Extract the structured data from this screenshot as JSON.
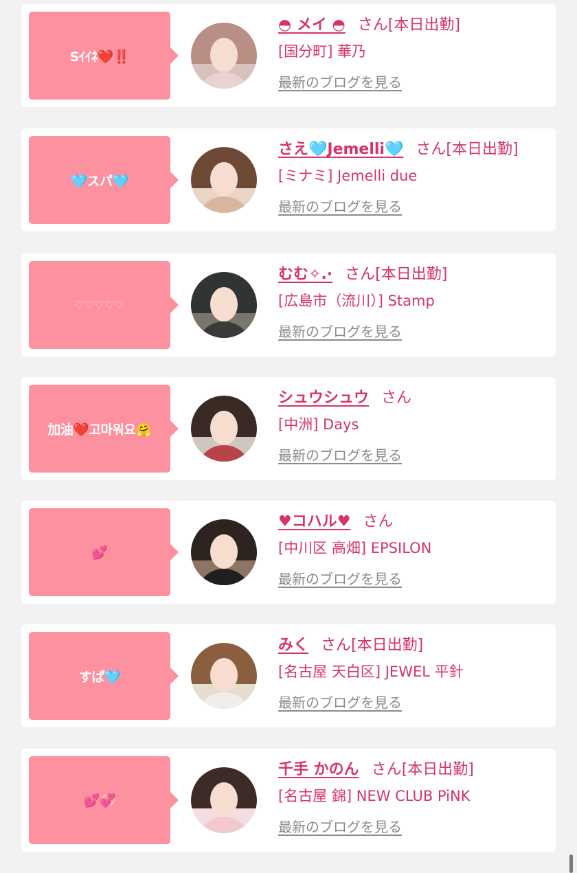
{
  "cards": [
    {
      "comment": "Sｲｲﾈ❤️‼️",
      "name": "◓ メイ ◓",
      "san": "さん",
      "status": "[本日出勤]",
      "store": "[国分町] 華乃",
      "blog_link": "最新のブログを見る",
      "avatar": {
        "hair": "#b98e84",
        "body": "#e8d3cf",
        "bg": "#d9c2bd"
      }
    },
    {
      "comment": "🩵スパ🩵",
      "name": "さえ🩵Jemelli🩵",
      "san": "さん",
      "status": "[本日出勤]",
      "store": "[ミナミ] Jemelli due",
      "blog_link": "最新のブログを見る",
      "avatar": {
        "hair": "#6e4a36",
        "body": "#d9b6a0",
        "bg": "#e9d5c8"
      }
    },
    {
      "comment": "♡♡♡♡♡",
      "name": "むむ✧.·",
      "san": "さん",
      "status": "[本日出勤]",
      "store": "[広島市（流川）] Stamp",
      "blog_link": "最新のブログを見る",
      "avatar": {
        "hair": "#2f3535",
        "body": "#3a3a3a",
        "bg": "#7a766d"
      }
    },
    {
      "comment": "加油❤️고마워요🤗",
      "name": "シュウシュウ",
      "san": "さん",
      "status": "",
      "store": "[中洲] Days",
      "blog_link": "最新のブログを見る",
      "avatar": {
        "hair": "#3a2a26",
        "body": "#b8434a",
        "bg": "#cfc6c0"
      }
    },
    {
      "comment": "💕",
      "name": "♥コハル♥",
      "san": "さん",
      "status": "",
      "store": "[中川区 高畑] EPSILON",
      "blog_link": "最新のブログを見る",
      "avatar": {
        "hair": "#2d2420",
        "body": "#1f1f1f",
        "bg": "#8c7565"
      }
    },
    {
      "comment": "すぱ🩵",
      "name": "みく",
      "san": "さん",
      "status": "[本日出勤]",
      "store": "[名古屋 天白区] JEWEL 平針",
      "blog_link": "最新のブログを見る",
      "avatar": {
        "hair": "#8a5e3e",
        "body": "#f1ede8",
        "bg": "#e6ddd2"
      }
    },
    {
      "comment": "💕💞",
      "name": "千手 かのん",
      "san": "さん",
      "status": "[本日出勤]",
      "store": "[名古屋 錦] NEW CLUB PiNK",
      "blog_link": "最新のブログを見る",
      "avatar": {
        "hair": "#3d2b28",
        "body": "#f2c9cf",
        "bg": "#f5dde2"
      }
    }
  ]
}
